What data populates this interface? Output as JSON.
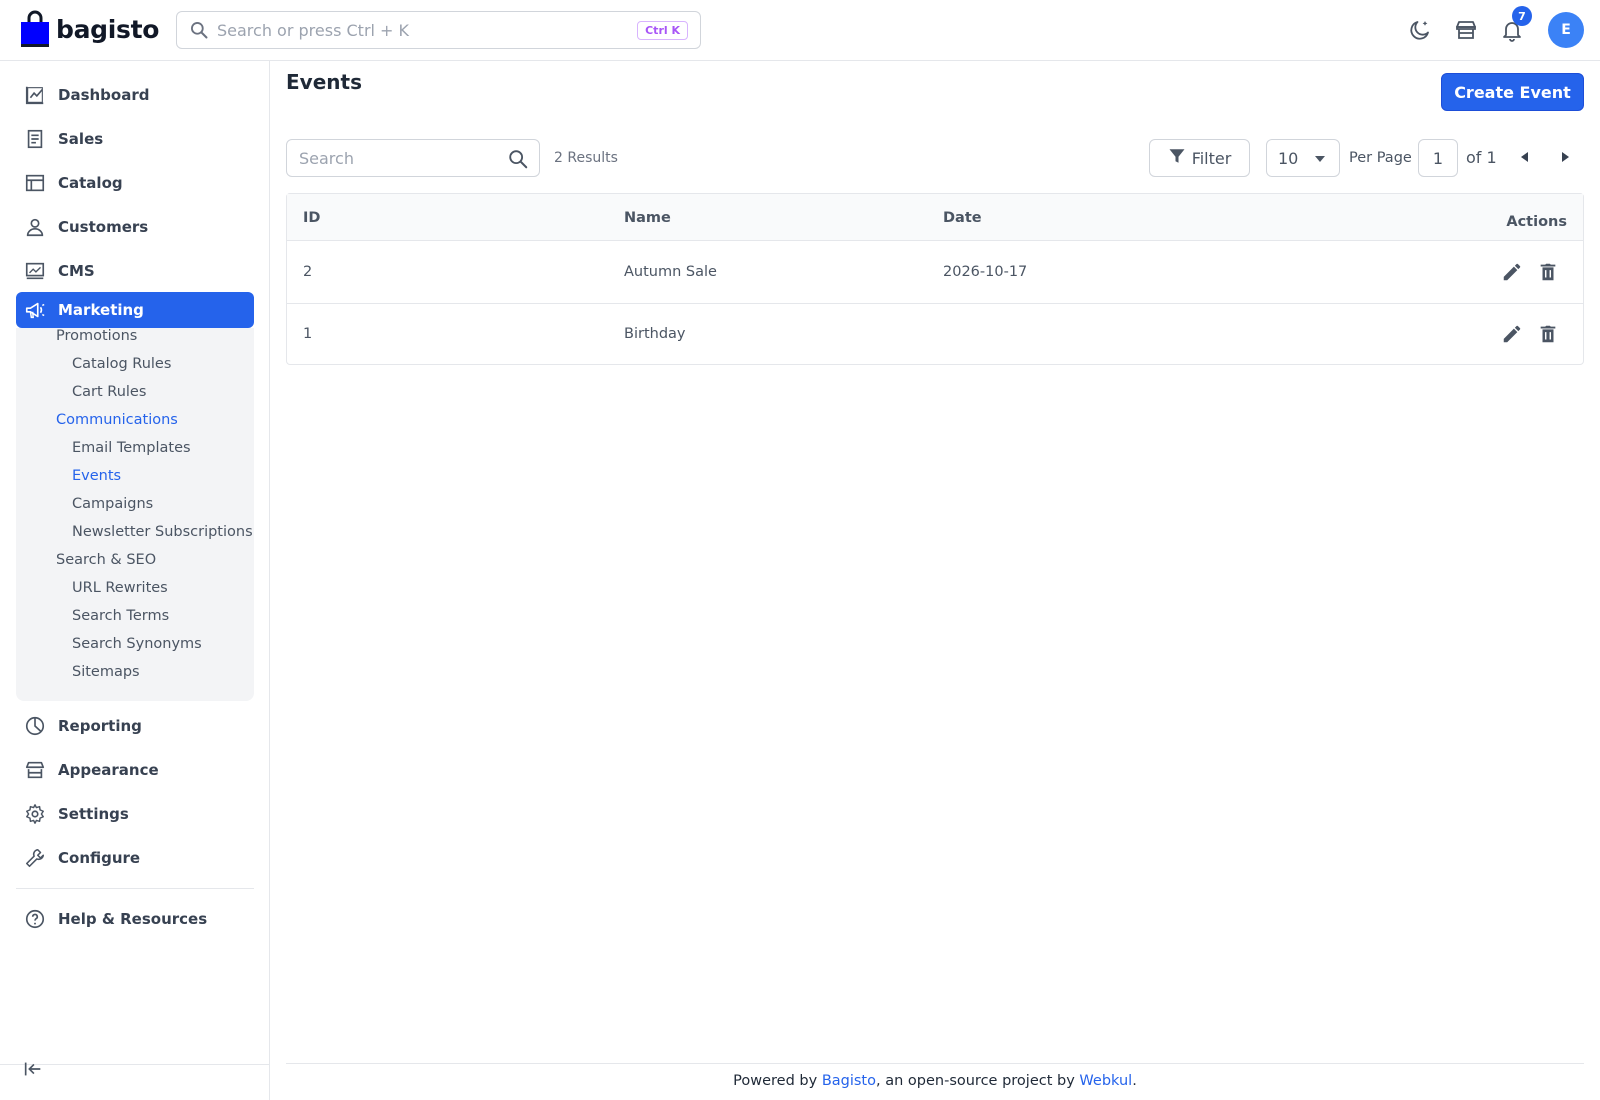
{
  "header": {
    "logo_text": "bagisto",
    "search_placeholder": "Search or press Ctrl + K",
    "search_shortcut": "Ctrl K",
    "notification_count": "7",
    "avatar_initial": "E"
  },
  "sidebar": {
    "items": [
      {
        "label": "Dashboard",
        "icon": "dashboard-icon"
      },
      {
        "label": "Sales",
        "icon": "sales-icon"
      },
      {
        "label": "Catalog",
        "icon": "catalog-icon"
      },
      {
        "label": "Customers",
        "icon": "customers-icon"
      },
      {
        "label": "CMS",
        "icon": "cms-icon"
      },
      {
        "label": "Marketing",
        "icon": "megaphone-icon",
        "active": true
      },
      {
        "label": "Reporting",
        "icon": "reporting-icon"
      },
      {
        "label": "Appearance",
        "icon": "appearance-icon"
      },
      {
        "label": "Settings",
        "icon": "gear-icon"
      },
      {
        "label": "Configure",
        "icon": "wrench-icon"
      },
      {
        "label": "Help & Resources",
        "icon": "help-icon"
      }
    ],
    "marketing_sub": [
      {
        "label": "Promotions",
        "level": 1
      },
      {
        "label": "Catalog Rules",
        "level": 2
      },
      {
        "label": "Cart Rules",
        "level": 2
      },
      {
        "label": "Communications",
        "level": 1,
        "active": true
      },
      {
        "label": "Email Templates",
        "level": 2
      },
      {
        "label": "Events",
        "level": 2,
        "active": true
      },
      {
        "label": "Campaigns",
        "level": 2
      },
      {
        "label": "Newsletter Subscriptions",
        "level": 2
      },
      {
        "label": "Search & SEO",
        "level": 1
      },
      {
        "label": "URL Rewrites",
        "level": 2
      },
      {
        "label": "Search Terms",
        "level": 2
      },
      {
        "label": "Search Synonyms",
        "level": 2
      },
      {
        "label": "Sitemaps",
        "level": 2
      }
    ]
  },
  "main": {
    "title": "Events",
    "create_button": "Create Event",
    "search_placeholder": "Search",
    "results_text": "2 Results",
    "filter_label": "Filter",
    "per_page_value": "10",
    "per_page_label": "Per Page",
    "current_page": "1",
    "of_pages": "of 1",
    "columns": [
      "ID",
      "Name",
      "Date",
      "Actions"
    ],
    "rows": [
      {
        "id": "2",
        "name": "Autumn Sale",
        "date": "2026-10-17"
      },
      {
        "id": "1",
        "name": "Birthday",
        "date": ""
      }
    ]
  },
  "footer": {
    "prefix": "Powered by ",
    "link1": "Bagisto",
    "middle": ", an open-source project by ",
    "link2": "Webkul",
    "suffix": "."
  },
  "colors": {
    "accent": "#2563eb",
    "sidebar_sub_bg": "#f3f4f6"
  }
}
